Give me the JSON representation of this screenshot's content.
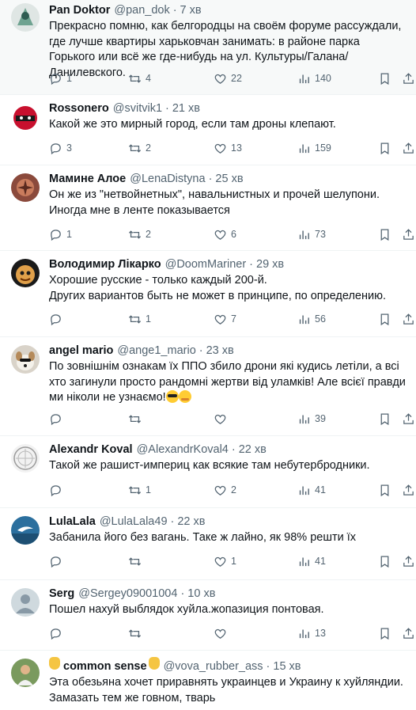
{
  "tweets": [
    {
      "name": "Pan Doktor",
      "handle": "@pan_dok",
      "time": "7 хв",
      "text": "Прекрасно помню, как белгородцы на своём форуме рассуждали, где лучше квартиры харьковчан занимать: в районе парка Горького или всё же где-нибудь на ул. Культуры/Галана/Данилевского.",
      "replies": "1",
      "retweets": "4",
      "likes": "22",
      "views": "140"
    },
    {
      "name": "Rossonero",
      "handle": "@svitvik1",
      "time": "21 хв",
      "text": "Какой же это мирный город, если там дроны клепают.",
      "replies": "3",
      "retweets": "2",
      "likes": "13",
      "views": "159"
    },
    {
      "name": "Мамине Алое",
      "handle": "@LenaDistyna",
      "time": "25 хв",
      "text": "Он же из \"нетвойнетных\", навальнистных и прочей шелупони. Иногда мне в ленте показывается",
      "replies": "1",
      "retweets": "2",
      "likes": "6",
      "views": "73"
    },
    {
      "name": "Володимир Лікарко",
      "handle": "@DoomMariner",
      "time": "29 хв",
      "text": "Хорошие русские - только каждый 200-й.\nДругих вариантов быть не может в принципе, по определению.",
      "replies": "",
      "retweets": "1",
      "likes": "7",
      "views": "56"
    },
    {
      "name": "angel mario",
      "handle": "@ange1_mario",
      "time": "23 хв",
      "text": "По зовнішнім ознакам їх ППО збило дрони які кудись летіли, а всі хто загинули просто рандомні жертви від уламків! Але всієї правди ми ніколи не узнаємо!",
      "replies": "",
      "retweets": "",
      "likes": "",
      "views": "39"
    },
    {
      "name": "Alexandr Koval",
      "handle": "@AlexandrKoval4",
      "time": "22 хв",
      "text": "Такой же рашист-империц как всякие там небутербродники.",
      "replies": "",
      "retweets": "1",
      "likes": "2",
      "views": "41"
    },
    {
      "name": "LulaLala",
      "handle": "@LulaLala49",
      "time": "22 хв",
      "text": "Забанила його без вагань. Таке ж лайно, як 98% решти їх",
      "replies": "",
      "retweets": "",
      "likes": "1",
      "views": "41"
    },
    {
      "name": "Serg",
      "handle": "@Sergey09001004",
      "time": "10 хв",
      "text": "Пошел нахуй выблядок хуйла.жопазиция понтовая.",
      "replies": "",
      "retweets": "",
      "likes": "",
      "views": "13"
    },
    {
      "name": "common sense",
      "handle": "@vova_rubber_ass",
      "time": "15 хв",
      "text": "Эта обезьяна хочет приравнять украинцев и Украину к хуйляндии. Замазать тем же говном, тварь",
      "replies": "",
      "retweets": "",
      "likes": "",
      "views": ""
    }
  ]
}
